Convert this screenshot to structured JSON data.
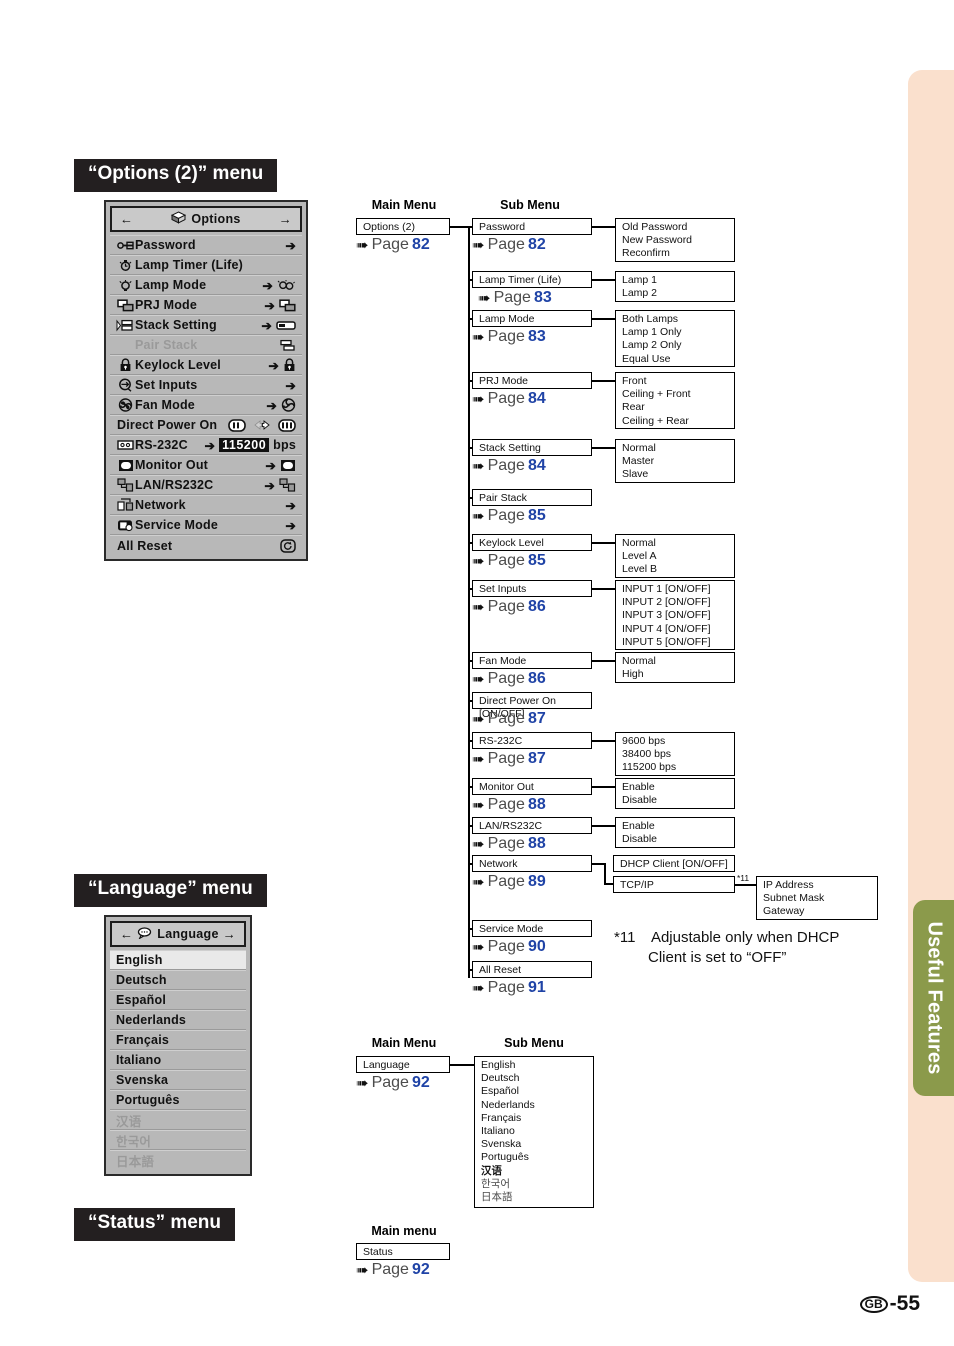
{
  "page": {
    "region_code": "GB",
    "number": "-55"
  },
  "side_tab": {
    "label": "Useful Features"
  },
  "sections": {
    "options2": {
      "banner": "“Options (2)” menu"
    },
    "language": {
      "banner": "“Language” menu"
    },
    "status": {
      "banner": "“Status” menu"
    }
  },
  "osd_options": {
    "title": "Options",
    "title_icon": "options-box-icon",
    "left_arrow": "←",
    "right_arrow": "→",
    "rows": [
      {
        "label": "Password",
        "icon": "key-icon",
        "right": "➔",
        "dim": false
      },
      {
        "label": "Lamp Timer (Life)",
        "icon": "lamp-timer-icon",
        "right": "",
        "dim": false
      },
      {
        "label": "Lamp Mode",
        "icon": "lamp-icon",
        "right": "➔",
        "right_icon": "lamp-pair-icon",
        "dim": false
      },
      {
        "label": "PRJ Mode",
        "icon": "prj-icon",
        "right": "➔",
        "right_icon": "prj-icon",
        "dim": false
      },
      {
        "label": "Stack Setting",
        "icon": "stack-icon",
        "right": "➔",
        "right_icon": "bar-icon",
        "dim": false
      },
      {
        "label": "Pair Stack",
        "icon": "",
        "right": "",
        "right_icon": "stack2-icon",
        "dim": true
      },
      {
        "label": "Keylock Level",
        "icon": "lock-icon",
        "right": "➔",
        "right_icon": "lock-icon",
        "dim": false
      },
      {
        "label": "Set Inputs",
        "icon": "input-icon",
        "right": "➔",
        "dim": false
      },
      {
        "label": "Fan Mode",
        "icon": "fan-icon",
        "right": "➔",
        "right_icon": "fan-icon",
        "dim": false
      },
      {
        "label": "Direct Power On",
        "icon": "",
        "right": "ON ⇐ ⇒ OFF",
        "dim": false
      },
      {
        "label": "RS-232C",
        "icon": "serial-icon",
        "right": "➔",
        "value": "115200",
        "unit": "bps",
        "dim": false
      },
      {
        "label": "Monitor Out",
        "icon": "monitor-icon",
        "right": "➔",
        "right_icon": "monitor-icon",
        "dim": false
      },
      {
        "label": "LAN/RS232C",
        "icon": "lan-icon",
        "right": "➔",
        "right_icon": "lan-icon",
        "dim": false
      },
      {
        "label": "Network",
        "icon": "network-icon",
        "right": "➔",
        "dim": false
      },
      {
        "label": "Service Mode",
        "icon": "service-icon",
        "right": "➔",
        "dim": false
      },
      {
        "label": "All Reset",
        "icon": "",
        "right": "",
        "right_icon": "reset-icon",
        "dim": false
      }
    ]
  },
  "osd_language": {
    "title": "Language",
    "title_icon": "speech-bubble-icon",
    "left_arrow": "←",
    "right_arrow": "→",
    "rows": [
      {
        "label": "English",
        "selected": true,
        "dim": false
      },
      {
        "label": "Deutsch",
        "selected": false,
        "dim": false
      },
      {
        "label": "Español",
        "selected": false,
        "dim": false
      },
      {
        "label": "Nederlands",
        "selected": false,
        "dim": false
      },
      {
        "label": "Français",
        "selected": false,
        "dim": false
      },
      {
        "label": "Italiano",
        "selected": false,
        "dim": false
      },
      {
        "label": "Svenska",
        "selected": false,
        "dim": false
      },
      {
        "label": "Português",
        "selected": false,
        "dim": false
      },
      {
        "label": "汉语",
        "selected": false,
        "dim": true
      },
      {
        "label": "한국어",
        "selected": false,
        "dim": true
      },
      {
        "label": "日本語",
        "selected": false,
        "dim": true
      }
    ]
  },
  "flow_options": {
    "col_main": "Main Menu",
    "col_sub": "Sub Menu",
    "page_word": "Page",
    "main": {
      "label": "Options (2)",
      "page": "82"
    },
    "items": [
      {
        "label": "Password",
        "page": "82",
        "sub": [
          "Old Password",
          "New Password",
          "Reconfirm"
        ]
      },
      {
        "label": "Lamp Timer (Life)",
        "page": "83",
        "sub": [
          "Lamp 1",
          "Lamp 2"
        ]
      },
      {
        "label": "Lamp Mode",
        "page": "83",
        "sub": [
          "Both Lamps",
          "Lamp 1 Only",
          "Lamp 2 Only",
          "Equal Use"
        ]
      },
      {
        "label": "PRJ Mode",
        "page": "84",
        "sub": [
          "Front",
          "Ceiling + Front",
          "Rear",
          "Ceiling + Rear"
        ]
      },
      {
        "label": "Stack Setting",
        "page": "84",
        "sub": [
          "Normal",
          "Master",
          "Slave"
        ]
      },
      {
        "label": "Pair Stack",
        "page": "85",
        "sub": []
      },
      {
        "label": "Keylock Level",
        "page": "85",
        "sub": [
          "Normal",
          "Level A",
          "Level B"
        ]
      },
      {
        "label": "Set Inputs",
        "page": "86",
        "sub": [
          "INPUT 1 [ON/OFF]",
          "INPUT 2 [ON/OFF]",
          "INPUT 3 [ON/OFF]",
          "INPUT 4 [ON/OFF]",
          "INPUT 5 [ON/OFF]"
        ]
      },
      {
        "label": "Fan Mode",
        "page": "86",
        "sub": [
          "Normal",
          "High"
        ]
      },
      {
        "label": "Direct Power On [ON/OFF]",
        "page": "87",
        "sub": []
      },
      {
        "label": "RS-232C",
        "page": "87",
        "sub": [
          "9600 bps",
          "38400 bps",
          "115200 bps"
        ]
      },
      {
        "label": "Monitor Out",
        "page": "88",
        "sub": [
          "Enable",
          "Disable"
        ]
      },
      {
        "label": "LAN/RS232C",
        "page": "88",
        "sub": [
          "Enable",
          "Disable"
        ]
      },
      {
        "label": "Network",
        "page": "89",
        "sub": []
      },
      {
        "label": "Service Mode",
        "page": "90",
        "sub": []
      },
      {
        "label": "All Reset",
        "page": "91",
        "sub": []
      }
    ],
    "network_children": [
      {
        "label": "DHCP Client [ON/OFF]"
      },
      {
        "label": "TCP/IP"
      }
    ],
    "tcpip_children": [
      "IP Address",
      "Subnet Mask",
      "Gateway"
    ],
    "tcpip_footnote_marker": "*11",
    "footnote": {
      "marker": "*11",
      "line1": "Adjustable only when DHCP",
      "line2": "Client is set to “OFF”"
    }
  },
  "flow_language": {
    "col_main": "Main Menu",
    "col_sub": "Sub Menu",
    "page_word": "Page",
    "main": {
      "label": "Language",
      "page": "92"
    },
    "sub": [
      "English",
      "Deutsch",
      "Español",
      "Nederlands",
      "Français",
      "Italiano",
      "Svenska",
      "Português",
      "汉语",
      "한국어",
      "日本語"
    ]
  },
  "flow_status": {
    "col_main": "Main menu",
    "page_word": "Page",
    "main": {
      "label": "Status",
      "page": "92"
    }
  },
  "colors": {
    "banner_bg": "#231f20",
    "page_link": "#1f43a6",
    "side_band": "#fae0cd",
    "side_tab": "#8b9a4b",
    "osd_bg": "#b8b8b8"
  }
}
